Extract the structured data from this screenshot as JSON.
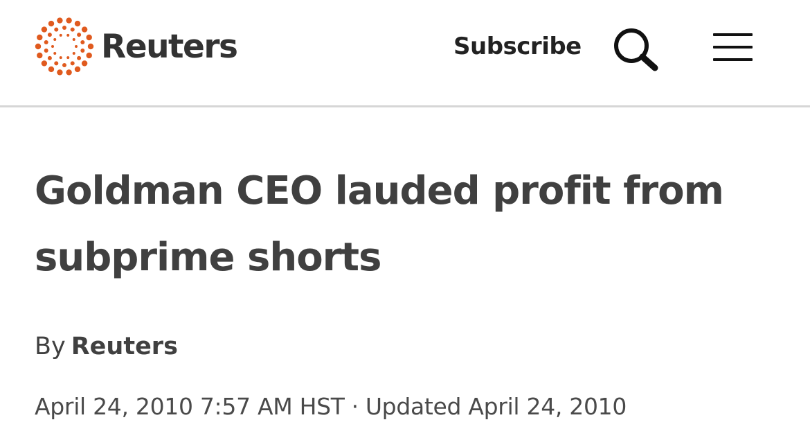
{
  "header": {
    "logo_text": "Reuters",
    "logo_color": "#e05a1e",
    "subscribe_label": "Subscribe",
    "search_icon": "search-icon",
    "menu_icon": "hamburger-menu-icon"
  },
  "article": {
    "headline": "Goldman CEO lauded profit from subprime shorts",
    "byline_prefix": "By",
    "author": "Reuters",
    "published": "April 24, 2010 7:57 AM HST",
    "separator": "·",
    "updated": "Updated April 24, 2010"
  }
}
